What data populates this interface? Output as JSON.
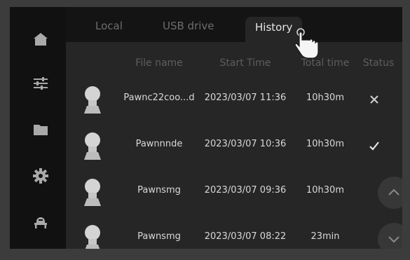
{
  "tabs": [
    {
      "label": "Local",
      "active": false
    },
    {
      "label": "USB drive",
      "active": false
    },
    {
      "label": "History",
      "active": true
    }
  ],
  "table": {
    "headers": [
      "File name",
      "Start Time",
      "Total time",
      "Status"
    ],
    "rows": [
      {
        "file": "Pawnc22coo...d",
        "start": "2023/03/07 11:36",
        "total": "10h30m",
        "status": "failed"
      },
      {
        "file": "Pawnnnde",
        "start": "2023/03/07 10:36",
        "total": "10h30m",
        "status": "completed"
      },
      {
        "file": "Pawnsmg",
        "start": "2023/03/07 09:36",
        "total": "10h30m",
        "status": ""
      },
      {
        "file": "Pawnsmg",
        "start": "2023/03/07 08:22",
        "total": "23min",
        "status": ""
      }
    ]
  },
  "sidebar": {
    "items": [
      {
        "icon": "home-icon"
      },
      {
        "icon": "sliders-icon"
      },
      {
        "icon": "folder-icon"
      },
      {
        "icon": "gear-icon"
      },
      {
        "icon": "printer-icon"
      }
    ]
  },
  "colors": {
    "background": "#262626",
    "active_text": "#e6e6e6",
    "inactive_text": "#6d6d6d"
  }
}
